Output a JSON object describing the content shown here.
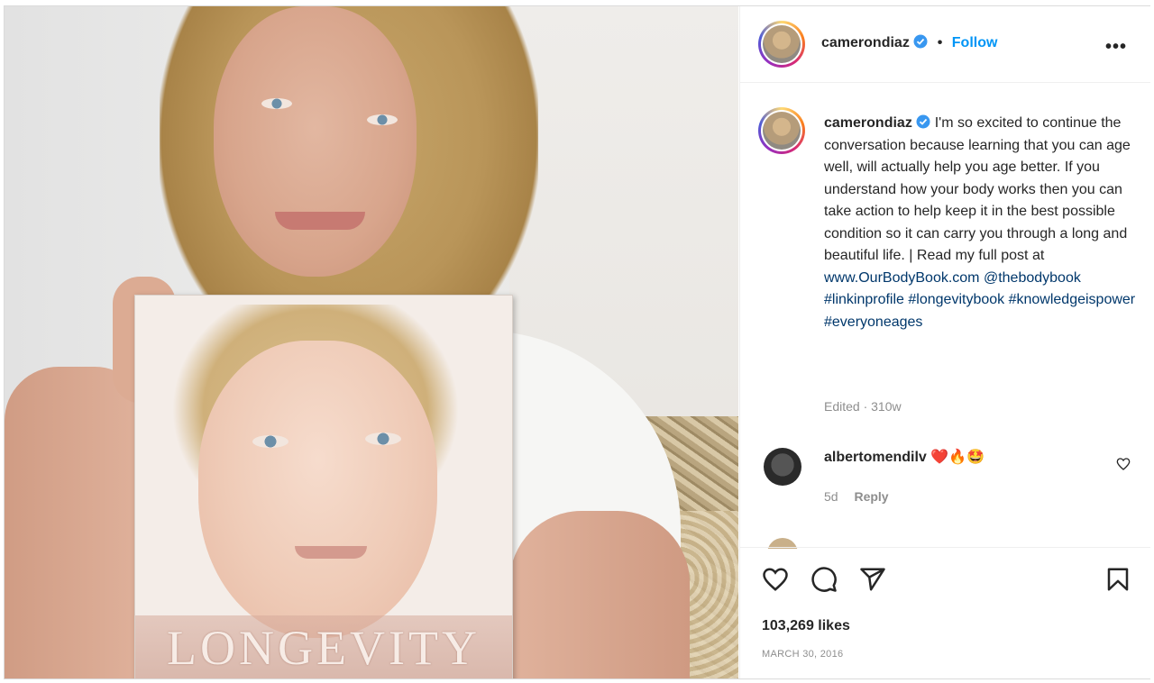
{
  "post": {
    "username": "camerondiaz",
    "follow_label": "Follow",
    "caption_segments": {
      "text": "I'm so excited to continue the conversation because learning that you can age well, will actually help you age better. If you understand how your body works then you can take action to help keep it in the best possible condition so it can carry you through a long and beautiful life. | Read my full post at ",
      "website": "www.OurBodyBook.com",
      "mention": "@thebodybook",
      "hashtags": [
        "#linkinprofile",
        "#longevitybook",
        "#knowledgeispower",
        "#everyoneages"
      ]
    },
    "caption_meta": "Edited · 310w",
    "book_title": "LONGEVITY",
    "likes": "103,269 likes",
    "date": "MARCH 30, 2016"
  },
  "comment": {
    "username": "albertomendilv",
    "emojis": "❤️🔥🤩",
    "age": "5d",
    "reply_label": "Reply"
  },
  "icons": {
    "more": "more-options-icon",
    "verified": "verified-badge-icon",
    "like": "heart-icon",
    "comment": "comment-icon",
    "share": "share-icon",
    "save": "bookmark-icon"
  },
  "colors": {
    "link": "#00376b",
    "follow": "#0095f6",
    "verified": "#3897f0"
  }
}
